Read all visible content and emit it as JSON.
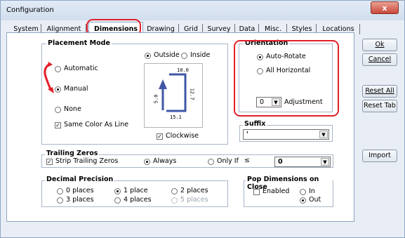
{
  "window": {
    "title": "Configuration",
    "close_glyph": "x"
  },
  "tabs": [
    "System",
    "Alignment",
    "Dimensions",
    "Drawing",
    "Grid",
    "Survey",
    "Data",
    "Misc.",
    "Styles",
    "Locations"
  ],
  "placement_mode": {
    "title": "Placement Mode",
    "automatic": "Automatic",
    "manual": "Manual",
    "none": "None",
    "same_color": "Same Color As Line",
    "outside": "Outside",
    "inside": "Inside",
    "clockwise": "Clockwise",
    "preview": {
      "top": "10.0",
      "left": "5.0",
      "right": "12.7",
      "bottom": "15.1"
    }
  },
  "orientation": {
    "title": "Orientation",
    "auto_rotate": "Auto-Rotate",
    "all_horizontal": "All Horizontal",
    "adjustment_value": "0",
    "adjustment_label": "Adjustment"
  },
  "suffix": {
    "title": "Suffix",
    "value": "'"
  },
  "trailing_zeros": {
    "title": "Trailing Zeros",
    "strip": "Strip Trailing Zeros",
    "always": "Always",
    "only_if": "Only If",
    "le_symbol": "≤",
    "value": "0"
  },
  "decimal_precision": {
    "title": "Decimal Precision",
    "options": [
      "0 places",
      "1 place",
      "2 places",
      "3 places",
      "4 places",
      "5 places"
    ]
  },
  "pop_dimensions": {
    "title": "Pop Dimensions on Close",
    "enabled": "Enabled",
    "in": "In",
    "out": "Out"
  },
  "buttons": {
    "ok": "Ok",
    "cancel": "Cancel",
    "reset_all": "Reset All",
    "reset_tab": "Reset Tab",
    "import": "Import"
  },
  "colors": {
    "highlight": "#e3202a",
    "arrow": "#3f57a6"
  }
}
